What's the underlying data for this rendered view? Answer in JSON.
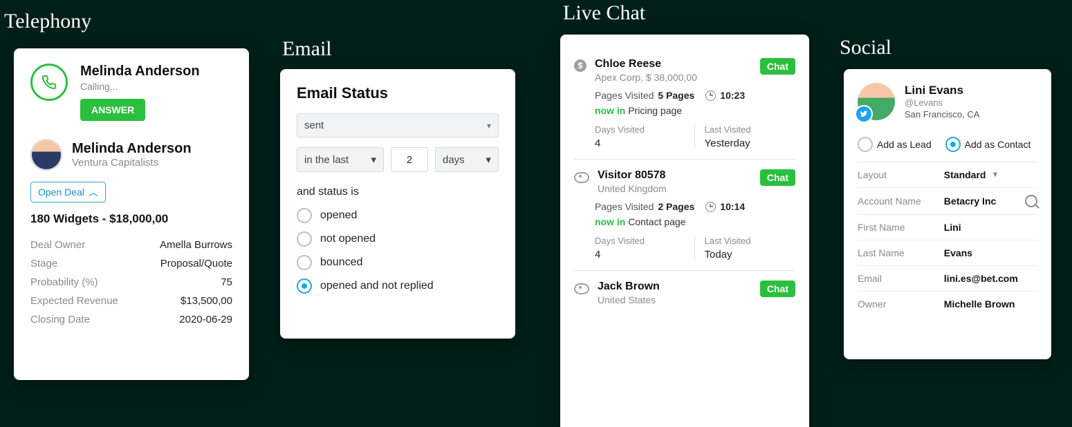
{
  "labels": {
    "telephony": "Telephony",
    "email": "Email",
    "live_chat": "Live Chat",
    "social": "Social"
  },
  "telephony": {
    "caller_name": "Melinda Anderson",
    "status": "Calling...",
    "answer_label": "ANSWER",
    "contact_name": "Melinda Anderson",
    "company": "Ventura Capitalists",
    "open_deal_label": "Open Deal",
    "deal_title": "180 Widgets - $18,000,00",
    "rows": [
      {
        "k": "Deal Owner",
        "v": "Amella Burrows"
      },
      {
        "k": "Stage",
        "v": "Proposal/Quote"
      },
      {
        "k": "Probability (%)",
        "v": "75"
      },
      {
        "k": "Expected  Revenue",
        "v": "$13,500,00"
      },
      {
        "k": "Closing Date",
        "v": "2020-06-29"
      }
    ]
  },
  "email": {
    "title": "Email Status",
    "status_select": "sent",
    "range_select": "in the last",
    "qty": "2",
    "unit_select": "days",
    "and_status_label": "and status is",
    "options": [
      {
        "label": "opened",
        "selected": false
      },
      {
        "label": "not opened",
        "selected": false
      },
      {
        "label": "bounced",
        "selected": false
      },
      {
        "label": "opened and not replied",
        "selected": true
      }
    ]
  },
  "chat": {
    "chat_label": "Chat",
    "pages_visited_label": "Pages Visited",
    "days_visited_label": "Days Visited",
    "last_visited_label": "Last Visited",
    "now_in_label": "now in",
    "visitors": [
      {
        "icon": "dollar",
        "name": "Chloe Reese",
        "sub": "Apex Corp, $ 38,000,00",
        "pages": "5 Pages",
        "time": "10:23",
        "now_in": "Pricing page",
        "days": "4",
        "last": "Yesterday"
      },
      {
        "icon": "eye",
        "name": "Visitor 80578",
        "sub": "United Kingdom",
        "pages": "2 Pages",
        "time": "10:14",
        "now_in": "Contact page",
        "days": "4",
        "last": "Today"
      },
      {
        "icon": "eye",
        "name": "Jack Brown",
        "sub": "United States"
      }
    ]
  },
  "social": {
    "name": "Lini Evans",
    "handle": "@Levans",
    "location": "San Francisco, CA",
    "add_lead_label": "Add as Lead",
    "add_contact_label": "Add as Contact",
    "add_selected": "contact",
    "fields": [
      {
        "k": "Layout",
        "v": "Standard",
        "dropdown": true
      },
      {
        "k": "Account Name",
        "v": "Betacry Inc",
        "search": true
      },
      {
        "k": "First Name",
        "v": "Lini"
      },
      {
        "k": "Last Name",
        "v": "Evans"
      },
      {
        "k": "Email",
        "v": "lini.es@bet.com"
      },
      {
        "k": "Owner",
        "v": "Michelle Brown"
      }
    ]
  }
}
